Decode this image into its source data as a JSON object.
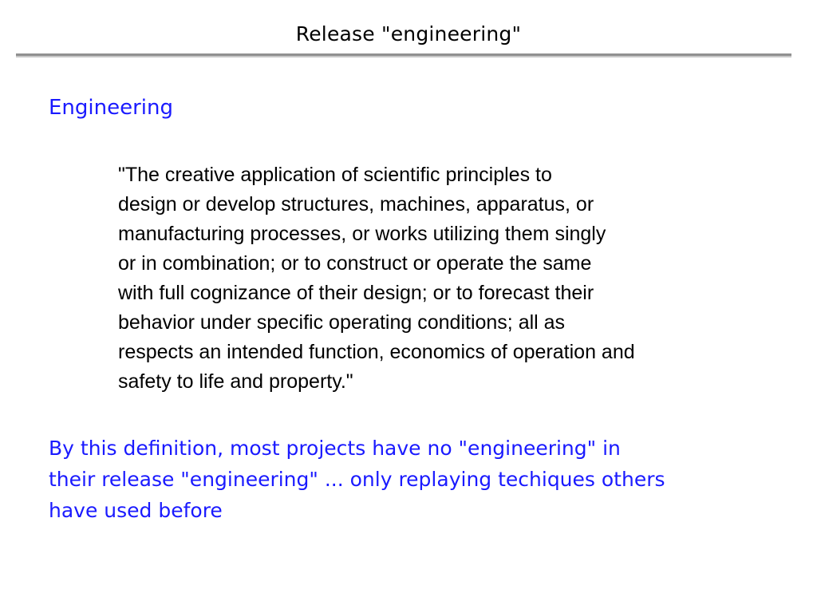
{
  "slide": {
    "title": "Release \"engineering\"",
    "heading": "Engineering",
    "quote_lines": [
      "\"The creative application of scientific principles to",
      "design or develop structures, machines, apparatus, or",
      "manufacturing processes, or works utilizing them singly",
      "or in combination; or to construct or operate the same",
      "with full cognizance of their design; or to forecast their",
      "behavior under specific operating conditions; all as",
      "respects an intended function, economics of operation and",
      "safety to life and property.\""
    ],
    "conclusion_lines": [
      "By this definition, most projects have no \"engineering\" in",
      "their release \"engineering\" ... only replaying techiques others",
      "have used before"
    ]
  },
  "colors": {
    "accent_blue": "#1a1aff",
    "text_black": "#000000",
    "rule_gray": "#909090"
  }
}
